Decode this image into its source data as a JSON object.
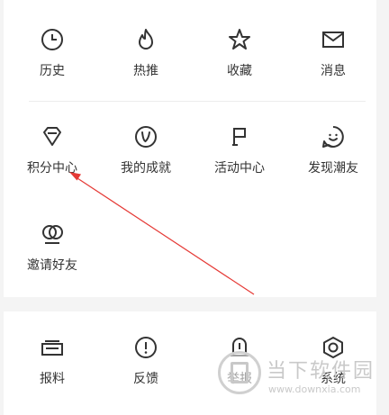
{
  "top_grid": [
    {
      "label": "历史",
      "icon": "clock-icon"
    },
    {
      "label": "热推",
      "icon": "flame-icon"
    },
    {
      "label": "收藏",
      "icon": "star-icon"
    },
    {
      "label": "消息",
      "icon": "envelope-icon"
    },
    {
      "label": "积分中心",
      "icon": "diamond-icon"
    },
    {
      "label": "我的成就",
      "icon": "v-badge-icon"
    },
    {
      "label": "活动中心",
      "icon": "flag-icon"
    },
    {
      "label": "发现潮友",
      "icon": "smile-chat-icon"
    },
    {
      "label": "邀请好友",
      "icon": "linked-circles-icon"
    }
  ],
  "bottom_grid": [
    {
      "label": "报料",
      "icon": "tip-box-icon"
    },
    {
      "label": "反馈",
      "icon": "exclamation-circle-icon"
    },
    {
      "label": "举报",
      "icon": "report-icon"
    },
    {
      "label": "系统",
      "icon": "hexagon-settings-icon"
    }
  ],
  "watermark": {
    "title": "当下软件园",
    "url": "www.downxia.com"
  },
  "colors": {
    "icon_stroke": "#333333",
    "arrow": "#e53935",
    "watermark": "#c9c9c9"
  }
}
